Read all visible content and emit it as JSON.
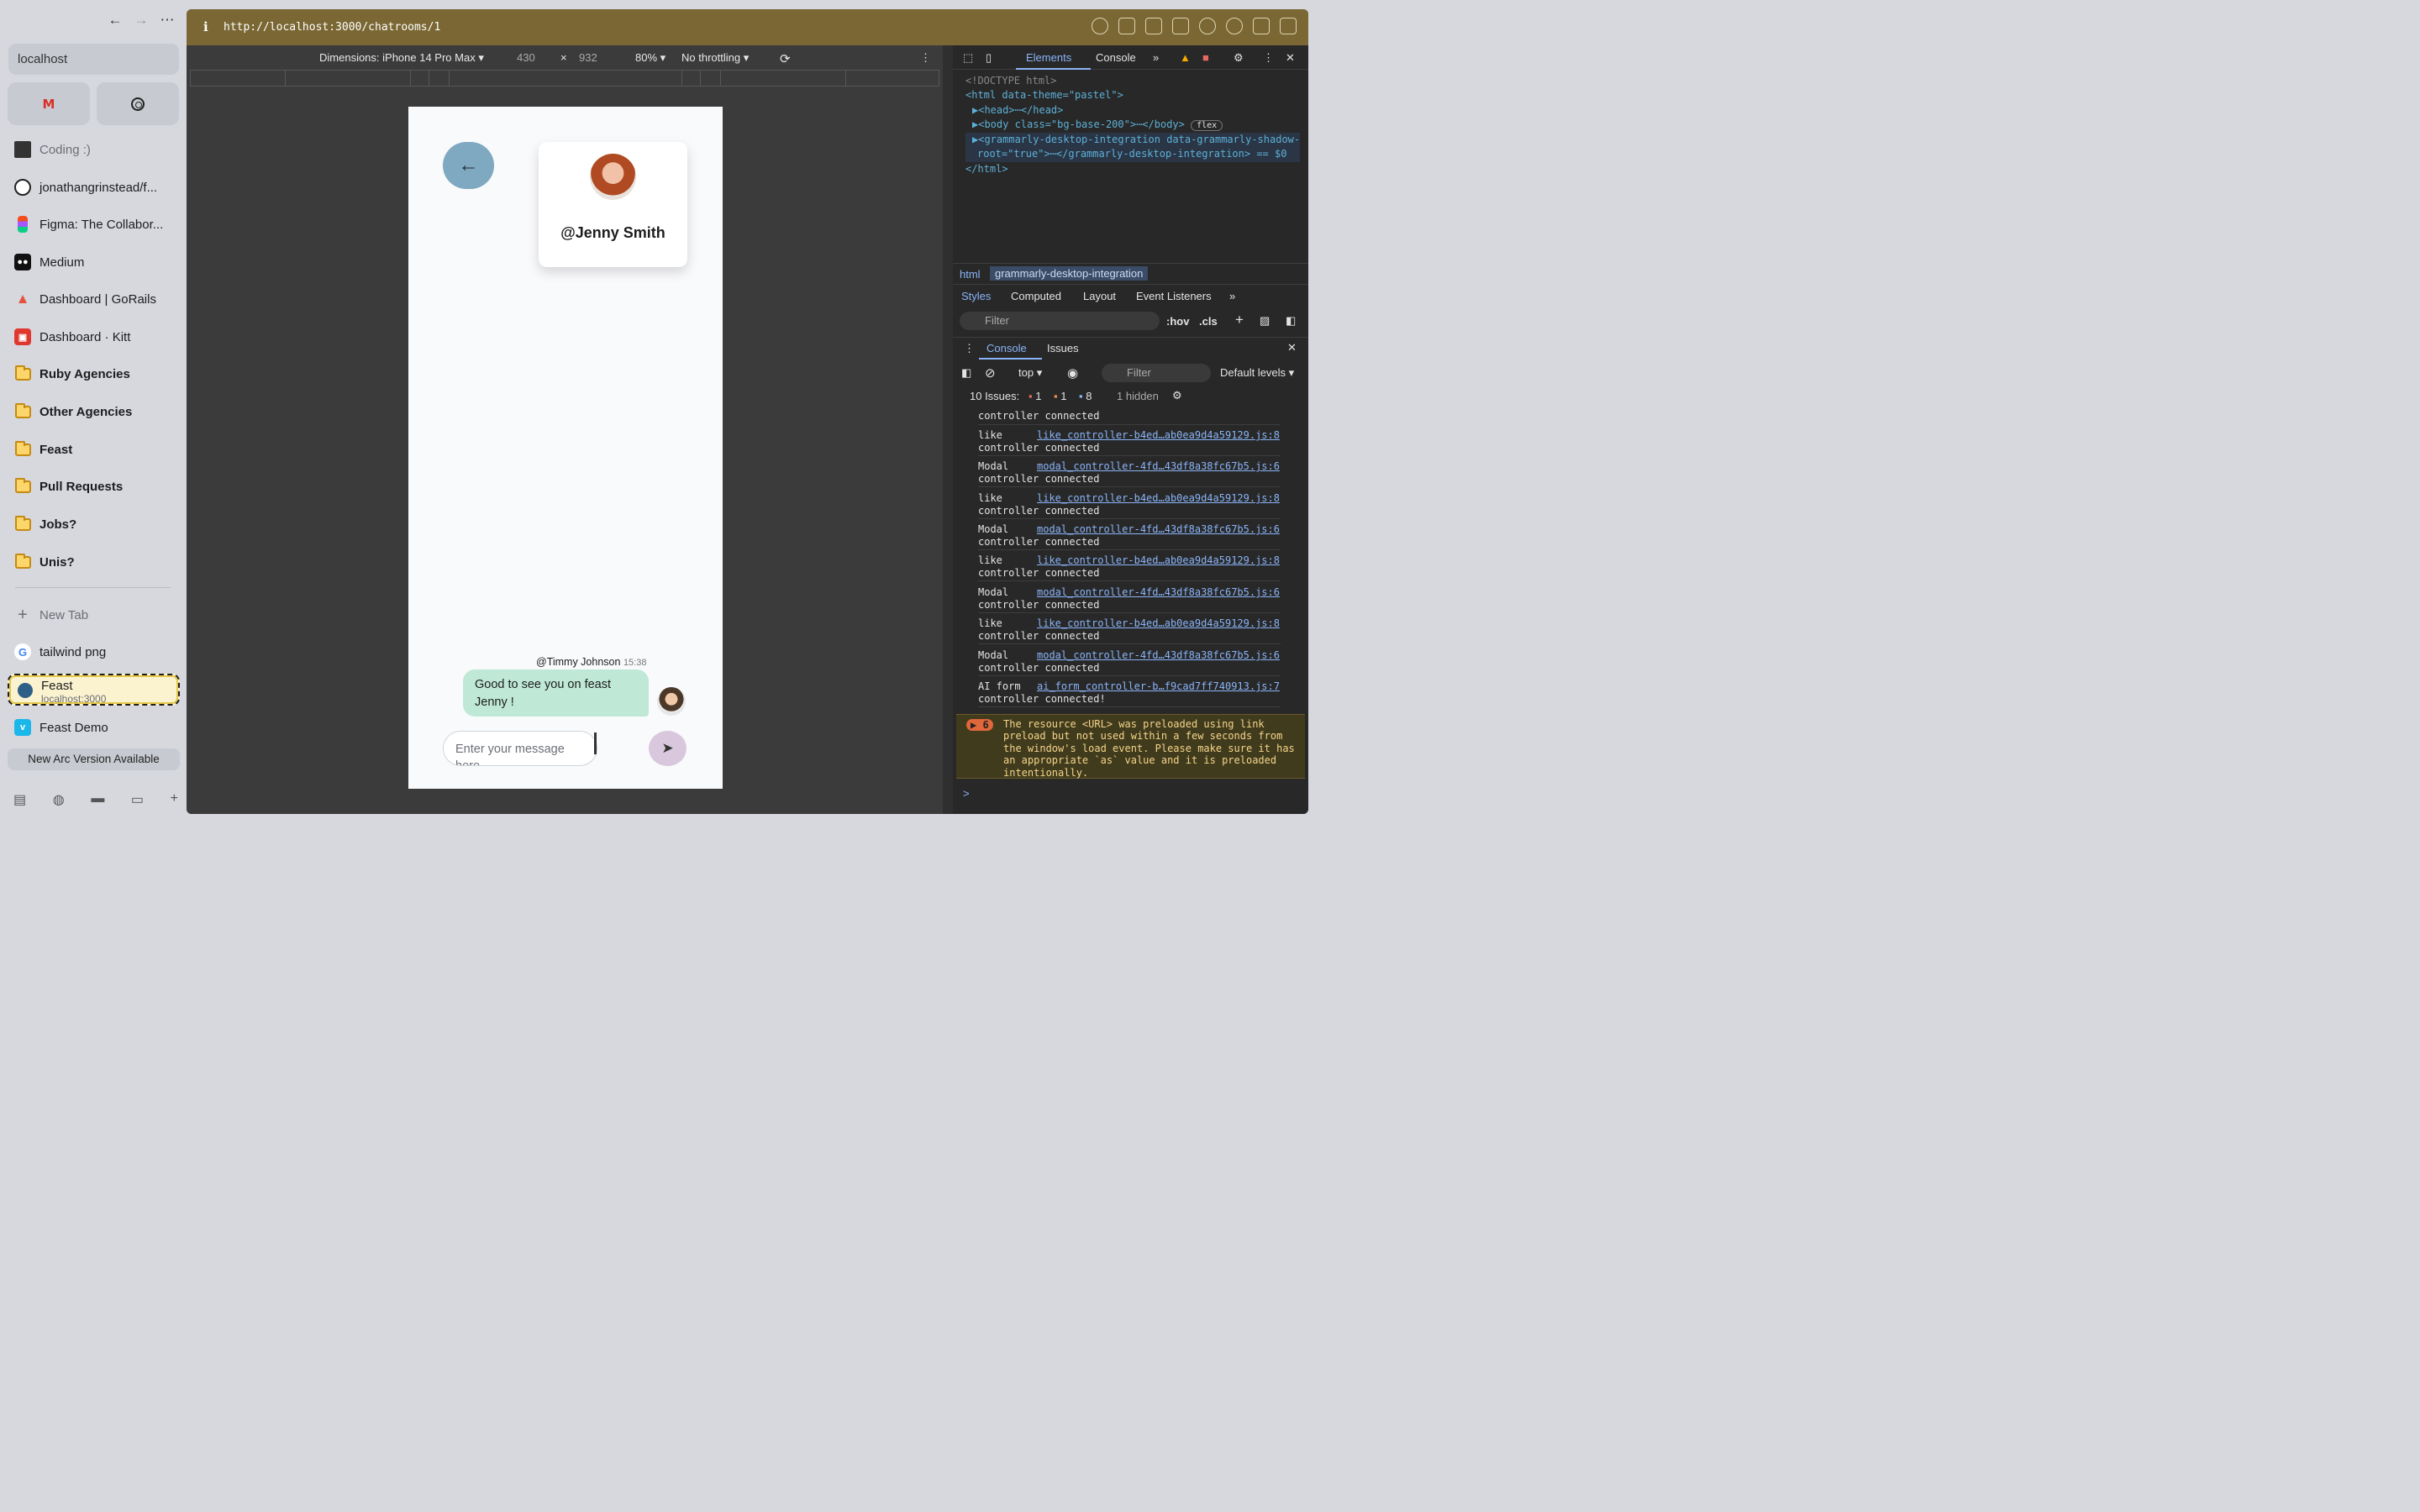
{
  "sidebar": {
    "search": "localhost",
    "pinned": [
      "Coding :)",
      "jonathangrinstead/f...",
      "Figma: The Collabor...",
      "Medium",
      "Dashboard | GoRails",
      "Dashboard · Kitt",
      "Ruby Agencies",
      "Other Agencies",
      "Feast",
      "Pull Requests",
      "Jobs?",
      "Unis?"
    ],
    "new_tab": "New Tab",
    "tabs": [
      "tailwind png",
      "Feast Demo"
    ],
    "active_tab": {
      "title": "Feast",
      "url": "localhost:3000"
    },
    "new_version": "New Arc Version Available"
  },
  "browser": {
    "url": "http://localhost:3000/chatrooms/1",
    "info": "i"
  },
  "device_toolbar": {
    "dimensions": "Dimensions: iPhone 14 Pro Max",
    "width": "430",
    "times": "×",
    "height": "932",
    "zoom": "80%",
    "throttling": "No throttling"
  },
  "chat": {
    "contact_name": "@Jenny Smith",
    "sender": "@Timmy Johnson",
    "time": "15:38",
    "message": "Good to see you on feast Jenny !",
    "input_placeholder": "Enter your message here"
  },
  "devtools": {
    "tabs": [
      "Elements",
      "Console"
    ],
    "code_lines": {
      "doctype": "<!DOCTYPE html>",
      "html_open": "<html data-theme=\"pastel\">",
      "head": "▶<head>⋯</head>",
      "body": "▶<body class=\"bg-base-200\">⋯</body>",
      "body_badge": "flex",
      "grammarly1": "▶<grammarly-desktop-integration data-grammarly-shadow-",
      "grammarly2": "root=\"true\">⋯</grammarly-desktop-integration> == $0",
      "html_close": "</html>"
    },
    "breadcrumbs": [
      "html",
      "grammarly-desktop-integration"
    ],
    "style_tabs": [
      "Styles",
      "Computed",
      "Layout",
      "Event Listeners"
    ],
    "filter_placeholder": "Filter",
    "hov": ":hov",
    "cls": ".cls",
    "drawer_tabs": [
      "Console",
      "Issues"
    ],
    "context": "top",
    "console_filter": "Filter",
    "levels": "Default levels",
    "issues_label": "10 Issues:",
    "issue_counts": [
      "1",
      "1",
      "8"
    ],
    "hidden": "1 hidden",
    "logs": [
      {
        "msg": "controller connected",
        "link": ""
      },
      {
        "msg": "like\ncontroller connected",
        "link": "like_controller-b4ed…ab0ea9d4a59129.js:8"
      },
      {
        "msg": "Modal\ncontroller connected",
        "link": "modal_controller-4fd…43df8a38fc67b5.js:6"
      },
      {
        "msg": "like\ncontroller connected",
        "link": "like_controller-b4ed…ab0ea9d4a59129.js:8"
      },
      {
        "msg": "Modal\ncontroller connected",
        "link": "modal_controller-4fd…43df8a38fc67b5.js:6"
      },
      {
        "msg": "like\ncontroller connected",
        "link": "like_controller-b4ed…ab0ea9d4a59129.js:8"
      },
      {
        "msg": "Modal\ncontroller connected",
        "link": "modal_controller-4fd…43df8a38fc67b5.js:6"
      },
      {
        "msg": "like\ncontroller connected",
        "link": "like_controller-b4ed…ab0ea9d4a59129.js:8"
      },
      {
        "msg": "Modal\ncontroller connected",
        "link": "modal_controller-4fd…43df8a38fc67b5.js:6"
      },
      {
        "msg": "AI form\ncontroller connected!",
        "link": "ai_form_controller-b…f9cad7ff740913.js:7"
      }
    ],
    "warning_count": "6",
    "warning": "The resource <URL> was preloaded using link preload but not used within a few seconds from the window's load event. Please make sure it has an appropriate `as` value and it is preloaded intentionally.",
    "prompt": ">"
  }
}
